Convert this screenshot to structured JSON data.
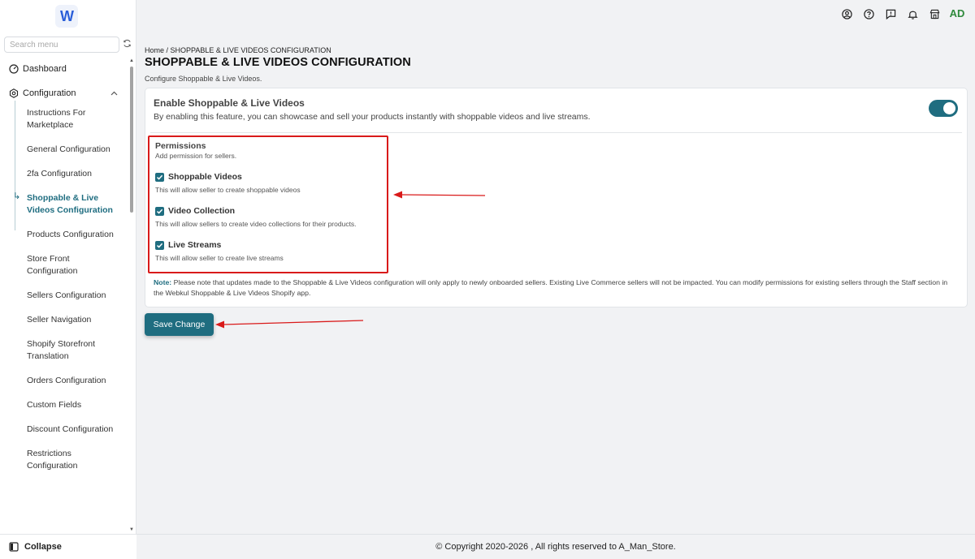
{
  "sidebar": {
    "search_placeholder": "Search menu",
    "top_items": [
      {
        "label": "Dashboard",
        "icon": "dashboard-icon"
      },
      {
        "label": "Configuration",
        "icon": "gear-icon"
      }
    ],
    "sub_items": [
      {
        "label": "Instructions For Marketplace"
      },
      {
        "label": "General Configuration"
      },
      {
        "label": "2fa Configuration"
      },
      {
        "label": "Shoppable & Live Videos Configuration",
        "active": true
      },
      {
        "label": "Products Configuration"
      },
      {
        "label": "Store Front Configuration"
      },
      {
        "label": "Sellers Configuration"
      },
      {
        "label": "Seller Navigation"
      },
      {
        "label": "Shopify Storefront Translation"
      },
      {
        "label": "Orders Configuration"
      },
      {
        "label": "Custom Fields"
      },
      {
        "label": "Discount Configuration"
      },
      {
        "label": "Restrictions Configuration"
      }
    ],
    "collapse_label": "Collapse"
  },
  "topbar": {
    "icons": [
      "user-circle-icon",
      "help-circle-icon",
      "feedback-icon",
      "bell-icon",
      "store-icon"
    ],
    "avatar": "AD"
  },
  "breadcrumb": "Home / SHOPPABLE & LIVE VIDEOS CONFIGURATION",
  "page": {
    "title": "SHOPPABLE & LIVE VIDEOS CONFIGURATION",
    "subtitle": "Configure Shoppable & Live Videos."
  },
  "feature": {
    "title": "Enable Shoppable & Live Videos",
    "description": "By enabling this feature, you can showcase and sell your products instantly with shoppable videos and live streams.",
    "enabled": true
  },
  "permissions": {
    "title": "Permissions",
    "subtitle": "Add permission for sellers.",
    "items": [
      {
        "label": "Shoppable Videos",
        "description": "This will allow seller to create shoppable videos",
        "checked": true
      },
      {
        "label": "Video Collection",
        "description": "This will allow sellers to create video collections for their products.",
        "checked": true
      },
      {
        "label": "Live Streams",
        "description": "This will allow seller to create live streams",
        "checked": true
      }
    ]
  },
  "note": {
    "label": "Note:",
    "text": "Please note that updates made to the Shoppable & Live Videos configuration will only apply to newly onboarded sellers. Existing Live Commerce sellers will not be impacted. You can modify permissions for existing sellers through the Staff section in the Webkul Shoppable & Live Videos Shopify app."
  },
  "save_label": "Save Change",
  "footer": "© Copyright 2020-2026 , All rights reserved to A_Man_Store.",
  "colors": {
    "accent": "#1f6d80",
    "annotation": "#d91a1a",
    "avatar": "#2f8a3c"
  }
}
